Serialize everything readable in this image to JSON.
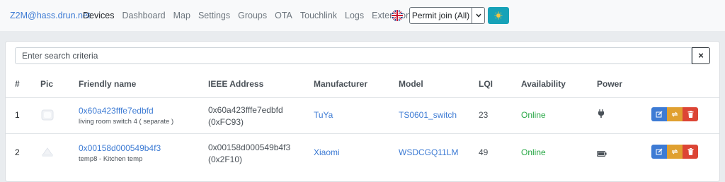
{
  "nav": {
    "brand": "Z2M@hass.drun.net",
    "links": [
      "Devices",
      "Dashboard",
      "Map",
      "Settings",
      "Groups",
      "OTA",
      "Touchlink",
      "Logs",
      "Extensions"
    ],
    "permit_join_label": "Permit join (All)"
  },
  "search": {
    "placeholder": "Enter search criteria",
    "clear_label": "×"
  },
  "table": {
    "headers": [
      "#",
      "Pic",
      "Friendly name",
      "IEEE Address",
      "Manufacturer",
      "Model",
      "LQI",
      "Availability",
      "Power"
    ],
    "rows": [
      {
        "index": "1",
        "friendly_name": "0x60a423fffe7edbfd",
        "description": "living room switch 4 ( separate )",
        "ieee": "0x60a423fffe7edbfd",
        "network_address": "(0xFC93)",
        "manufacturer": "TuYa",
        "model": "TS0601_switch",
        "lqi": "23",
        "availability": "Online",
        "power_icon": "plug-icon"
      },
      {
        "index": "2",
        "friendly_name": "0x00158d000549b4f3",
        "description": "temp8 - Kitchen temp",
        "ieee": "0x00158d000549b4f3",
        "network_address": "(0x2F10)",
        "manufacturer": "Xiaomi",
        "model": "WSDCGQ11LM",
        "lqi": "49",
        "availability": "Online",
        "power_icon": "battery-icon"
      }
    ]
  },
  "colors": {
    "link": "#3d7bd4",
    "online": "#28a745",
    "edit": "#3d7bd4",
    "rename": "#e0a030",
    "delete": "#dc4535",
    "theme_button": "#17a2b8"
  }
}
